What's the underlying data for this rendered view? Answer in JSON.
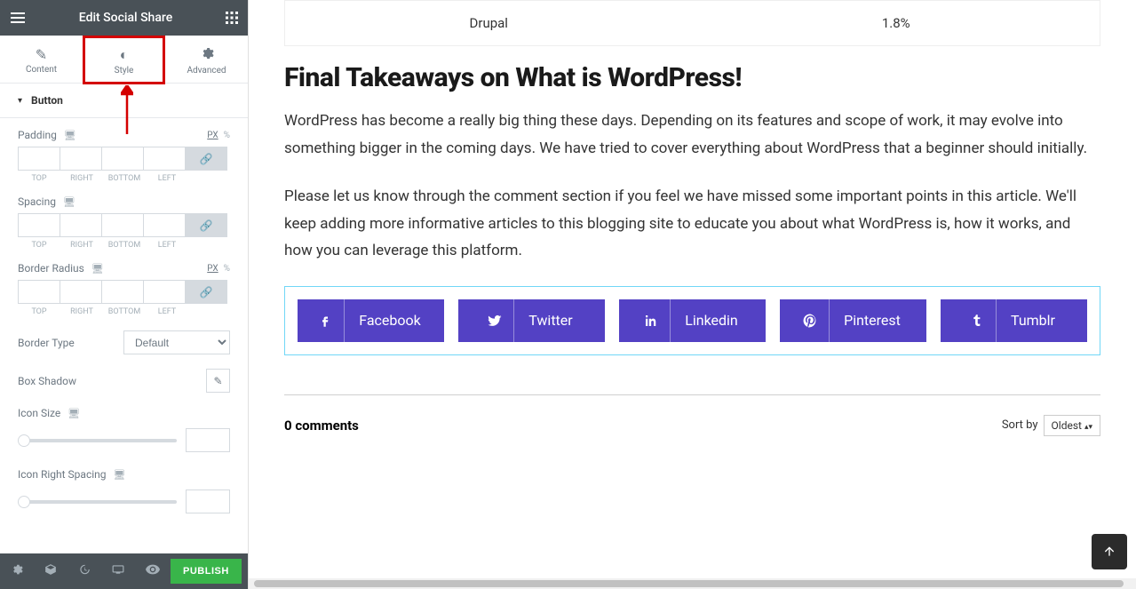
{
  "header": {
    "title": "Edit Social Share"
  },
  "tabs": {
    "content": "Content",
    "style": "Style",
    "advanced": "Advanced"
  },
  "section": {
    "button": "Button"
  },
  "controls": {
    "padding_label": "Padding",
    "spacing_label": "Spacing",
    "border_radius_label": "Border Radius",
    "border_type_label": "Border Type",
    "box_shadow_label": "Box Shadow",
    "icon_size_label": "Icon Size",
    "icon_right_spacing_label": "Icon Right Spacing",
    "unit_px": "PX",
    "unit_pct": "%",
    "sides": {
      "top": "TOP",
      "right": "RIGHT",
      "bottom": "BOTTOM",
      "left": "LEFT"
    },
    "default_option": "Default"
  },
  "footer": {
    "publish": "PUBLISH"
  },
  "table": {
    "col1": "Drupal",
    "col2": "1.8%"
  },
  "article": {
    "heading": "Final Takeaways on What is WordPress!",
    "p1": "WordPress has become a really big thing these days. Depending on its features and scope of work, it may evolve into something bigger in the coming days. We have tried to cover everything about WordPress that a beginner should initially.",
    "p2": "Please let us know through the comment section if you feel we have missed some important points in this article. We'll keep adding more informative articles to this blogging site to educate you about what WordPress is, how it works, and how you can leverage this platform."
  },
  "social": {
    "facebook": "Facebook",
    "twitter": "Twitter",
    "linkedin": "Linkedin",
    "pinterest": "Pinterest",
    "tumblr": "Tumblr"
  },
  "comments": {
    "count": "0 comments",
    "sort_label": "Sort by",
    "sort_value": "Oldest"
  }
}
